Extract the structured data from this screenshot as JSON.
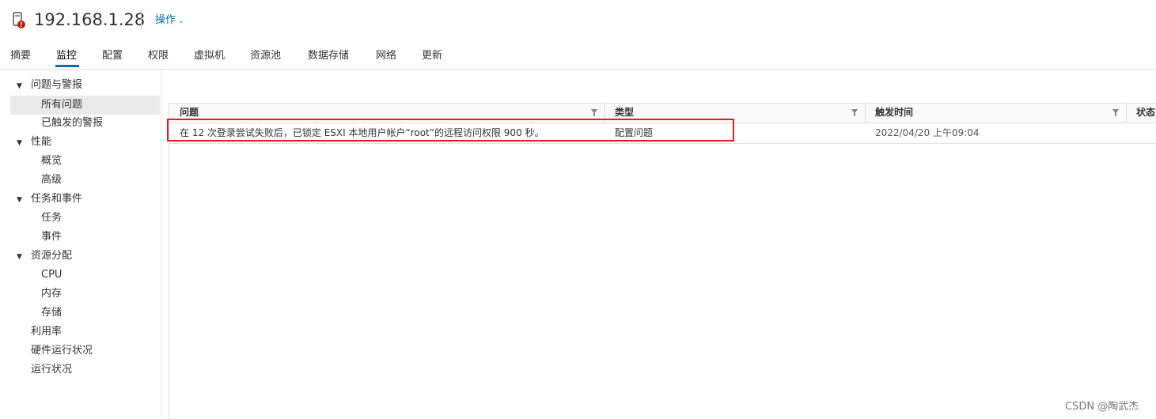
{
  "header": {
    "host_name": "192.168.1.28",
    "actions_label": "操作",
    "icon": "host-warning-icon"
  },
  "tabs": [
    {
      "label": "摘要"
    },
    {
      "label": "监控",
      "active": true
    },
    {
      "label": "配置"
    },
    {
      "label": "权限"
    },
    {
      "label": "虚拟机"
    },
    {
      "label": "资源池"
    },
    {
      "label": "数据存储"
    },
    {
      "label": "网络"
    },
    {
      "label": "更新"
    }
  ],
  "sidebar": {
    "sections": [
      {
        "label": "问题与警报",
        "expanded": true,
        "items": [
          "所有问题",
          "已触发的警报"
        ]
      },
      {
        "label": "性能",
        "expanded": true,
        "items": [
          "概览",
          "高级"
        ]
      },
      {
        "label": "任务和事件",
        "expanded": true,
        "items": [
          "任务",
          "事件"
        ]
      },
      {
        "label": "资源分配",
        "expanded": true,
        "items": [
          "CPU",
          "内存",
          "存储"
        ]
      }
    ],
    "links": [
      "利用率",
      "硬件运行状况",
      "运行状况"
    ],
    "selected": "所有问题"
  },
  "table": {
    "columns": [
      "问题",
      "类型",
      "触发时间",
      "状态"
    ],
    "rows": [
      {
        "issue": "在 12 次登录尝试失败后，已锁定 ESXI 本地用户帐户“root”的远程访问权限 900 秒。",
        "type": "配置问题",
        "time": "2022/04/20 上午09:04",
        "status": ""
      }
    ]
  },
  "colors": {
    "accent": "#0072a3",
    "highlight_border": "#e02020",
    "warning": "#c21d00"
  },
  "watermark": "CSDN @陶武杰"
}
